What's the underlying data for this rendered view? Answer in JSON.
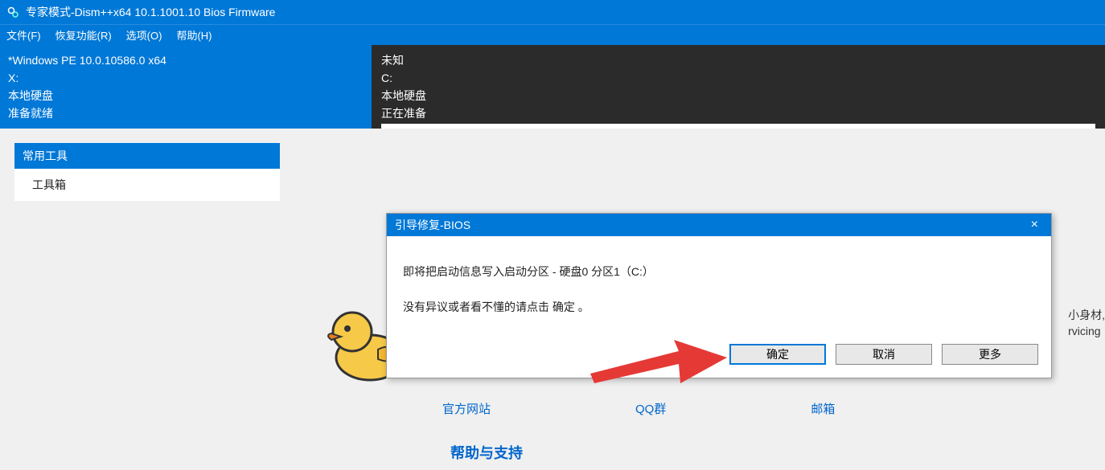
{
  "titlebar": {
    "title": "专家模式-Dism++x64 10.1.1001.10 Bios Firmware"
  },
  "menubar": {
    "file": "文件(F)",
    "recovery": "恢复功能(R)",
    "options": "选项(O)",
    "help": "帮助(H)"
  },
  "infopanel": {
    "line1": "*Windows PE 10.0.10586.0 x64",
    "line2": "X:",
    "line3": "本地硬盘",
    "line4": "准备就绪"
  },
  "darkpanel": {
    "line1": "未知",
    "line2": "C:",
    "line3": "本地硬盘",
    "line4": "正在准备"
  },
  "sidebar": {
    "header": "常用工具",
    "item1": "工具箱"
  },
  "dialog": {
    "title": "引导修复-BIOS",
    "line1": "即将把启动信息写入启动分区 - 硬盘0 分区1（C:）",
    "line2": "没有异议或者看不懂的请点击 确定 。",
    "ok": "确定",
    "cancel": "取消",
    "more": "更多"
  },
  "links": {
    "website": "官方网站",
    "qq": "QQ群",
    "email": "邮箱"
  },
  "help_title": "帮助与支持",
  "side_text": {
    "l1": "小身材,",
    "l2": "rvicing"
  }
}
